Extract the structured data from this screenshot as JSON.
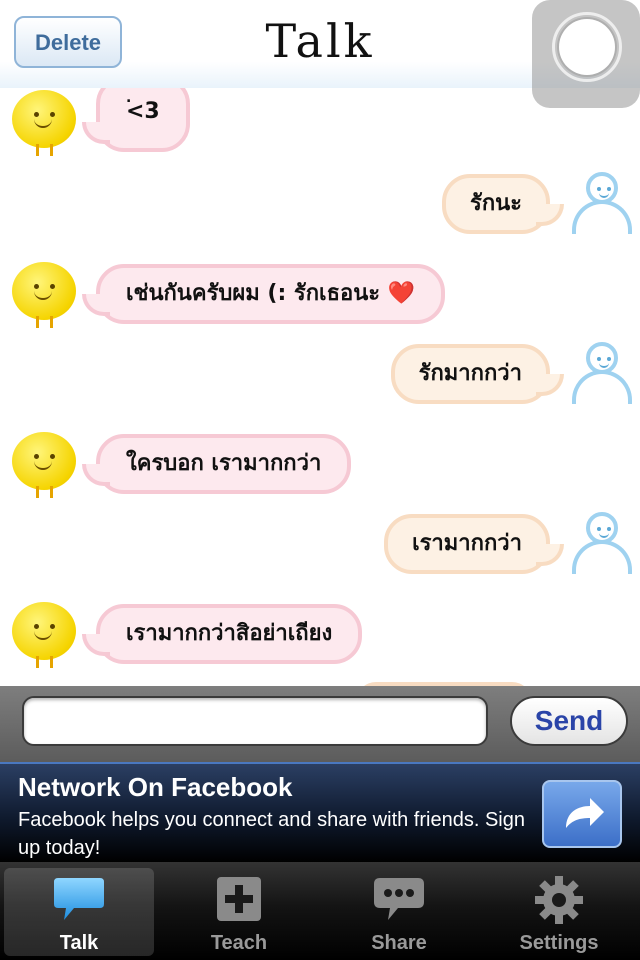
{
  "header": {
    "delete_label": "Delete",
    "title": "Talk"
  },
  "messages": [
    {
      "side": "left",
      "text": "<3"
    },
    {
      "side": "right",
      "text": "รักนะ"
    },
    {
      "side": "left",
      "text": "เช่นกันครับผม (: รักเธอนะ ❤️"
    },
    {
      "side": "right",
      "text": "รักมากกว่า"
    },
    {
      "side": "left",
      "text": "ใครบอก เรามากกว่า"
    },
    {
      "side": "right",
      "text": "เรามากกว่า"
    },
    {
      "side": "left",
      "text": "เรามากกว่าสิอย่าเถียง"
    }
  ],
  "input": {
    "value": "",
    "send_label": "Send"
  },
  "ad": {
    "title": "Network On Facebook",
    "body": "Facebook helps you connect and share with friends. Sign up today!"
  },
  "tabs": [
    {
      "label": "Talk",
      "icon": "speech-bubble-icon",
      "active": true
    },
    {
      "label": "Teach",
      "icon": "plus-square-icon",
      "active": false
    },
    {
      "label": "Share",
      "icon": "chat-dots-icon",
      "active": false
    },
    {
      "label": "Settings",
      "icon": "gear-icon",
      "active": false
    }
  ],
  "colors": {
    "accent": "#2a44a8",
    "left_bubble": "#fde9ee",
    "right_bubble": "#fdf1e4"
  }
}
